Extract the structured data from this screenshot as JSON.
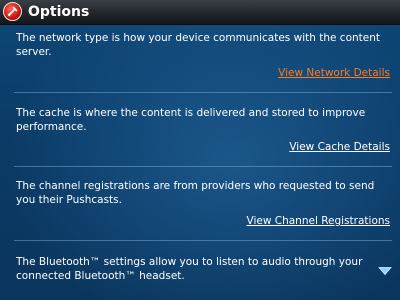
{
  "window": {
    "title": "Options",
    "icon": "blackberry-options-icon"
  },
  "sections": [
    {
      "description": "The network type is how your device communicates with the content server.",
      "link": "View Network Details",
      "focused": true
    },
    {
      "description": "The cache is where the content is delivered and stored to improve performance.",
      "link": "View Cache Details",
      "focused": false
    },
    {
      "description": "The channel registrations are from providers who requested to send you their Pushcasts.",
      "link": "View Channel Registrations",
      "focused": false
    },
    {
      "description": "The Bluetooth™ settings allow you to listen to audio through your connected Bluetooth™ headset.",
      "link": null,
      "focused": false
    }
  ],
  "scroll_indicator": "chevron-down-icon",
  "colors": {
    "background": "#0b3b66",
    "titlebar": "#22262b",
    "focused_link": "#ff7a1a",
    "text": "#ffffff"
  }
}
